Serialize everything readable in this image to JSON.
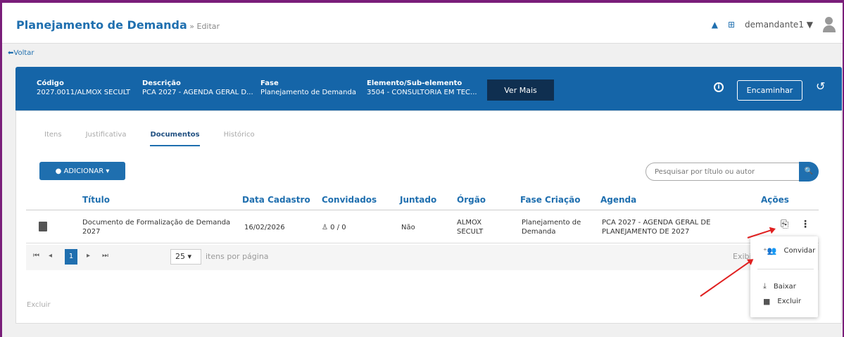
{
  "header": {
    "title": "Planejamento de Demanda",
    "crumb": " » Editar",
    "user": "demandante1",
    "grid_icon": "grid-icon",
    "bell_icon": "bell-icon"
  },
  "back_label": "Voltar",
  "banner": {
    "codigo_label": "Código",
    "codigo_value": "2027.0011/ALMOX SECULT",
    "descricao_label": "Descrição",
    "descricao_value": "PCA 2027 - AGENDA GERAL D...",
    "fase_label": "Fase",
    "fase_value": "Planejamento de Demanda",
    "elemento_label": "Elemento/Sub-elemento",
    "elemento_value": "3504 - CONSULTORIA EM TEC...",
    "ver_mais": "Ver Mais",
    "encaminhar": "Encaminhar"
  },
  "tabs": [
    "Itens",
    "Justificativa",
    "Documentos",
    "Histórico"
  ],
  "adicionar": "ADICIONAR",
  "search_placeholder": "Pesquisar por título ou autor",
  "table": {
    "headers": [
      "Título",
      "Data Cadastro",
      "Convidados",
      "Juntado",
      "Órgão",
      "Fase Criação",
      "Agenda",
      "Ações"
    ],
    "row": {
      "titulo": "Documento de Formalização de Demanda 2027",
      "data": "16/02/2026",
      "convidados": "0 / 0",
      "juntado": "Não",
      "orgao": "ALMOX SECULT",
      "fase": "Planejamento de Demanda",
      "agenda": "PCA 2027 - AGENDA GERAL DE PLANEJAMENTO DE 2027"
    }
  },
  "pager": {
    "page": "1",
    "per_page": "25",
    "per_page_label": "itens por página",
    "exibindo": "Exibind"
  },
  "excluir_link": "Excluir",
  "menu": {
    "convidar": "Convidar",
    "baixar": "Baixar",
    "excluir": "Excluir"
  },
  "colors": {
    "primary": "#1f6faf",
    "banner": "#1565a8",
    "dark_button": "#0f2f50",
    "annotation": "#e02020"
  }
}
